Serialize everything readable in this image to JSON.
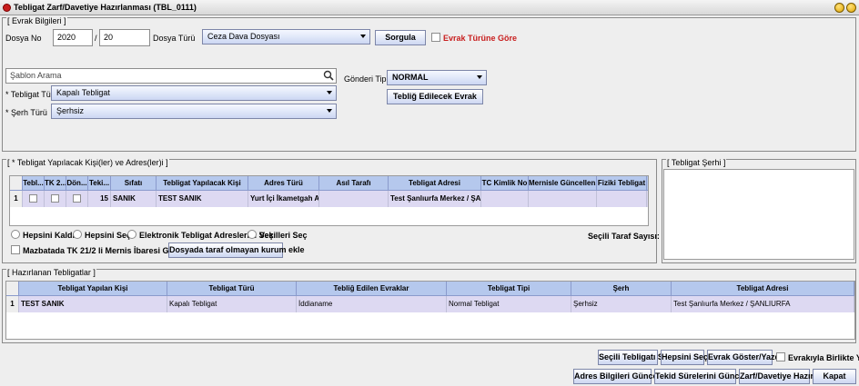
{
  "window": {
    "title": "Tebligat Zarf/Davetiye Hazırlanması (TBL_0111)"
  },
  "evrak": {
    "legend": "[ Evrak Bilgileri ]",
    "dosya_no_label": "Dosya No",
    "year": "2020",
    "slash": "/",
    "number": "20",
    "dosya_turu_label": "Dosya Türü",
    "dosya_turu_value": "Ceza Dava Dosyası",
    "sorgula": "Sorgula",
    "evrak_turune_gore": "Evrak Türüne Göre",
    "sablon_placeholder": "Şablon Arama",
    "tebligat_turu_label": "* Tebligat Türü",
    "tebligat_turu_value": "Kapalı Tebligat",
    "serh_turu_label": "* Şerh Türü",
    "serh_turu_value": "Şerhsiz",
    "gonderi_tipi_label": "Gönderi Tipi",
    "gonderi_tipi_value": "NORMAL",
    "teblig_edilecek": "Tebliğ Edilecek Evrak"
  },
  "kisiler": {
    "legend": "[ * Tebligat Yapılacak Kişi(ler) ve Adres(ler)i ]",
    "columns": [
      "Tebl...",
      "TK 2...",
      "Dön...",
      "Teki...",
      "Sıfatı",
      "Tebligat Yapılacak Kişi",
      "Adres Türü",
      "Asıl Tarafı",
      "Tebligat Adresi",
      "TC Kimlik No",
      "Mernisle Güncellen...",
      "Fiziki Tebligat"
    ],
    "row": {
      "num": "1",
      "teki": "15",
      "sifat": "SANIK",
      "kisi": "TEST SANIK",
      "adres_turu": "Yurt İçi İkametgah A...",
      "asil": "",
      "adres": "Test Şanlıurfa Merkez / ŞAN...",
      "tc": "",
      "mernis": "",
      "fiziki": ""
    },
    "radio_hepsini_kaldir": "Hepsini Kaldır",
    "radio_hepsini_sec": "Hepsini Seç",
    "radio_elektronik": "Elektronik Tebligat Adreslerini Seç",
    "radio_vekilleri": "Vekilleri Seç",
    "secili_taraf": "Seçili Taraf Sayısı: 0",
    "mazbatada": "Mazbatada TK 21/2 li Mernis İbaresi Görünsün",
    "dosyada_btn": "Dosyada taraf olmayan kurum ekle"
  },
  "serhi": {
    "legend": "[ Tebligat Şerhi ]"
  },
  "hazirlanan": {
    "legend": "[ Hazırlanan Tebligatlar ]",
    "columns": [
      "Tebligat Yapılan Kişi",
      "Tebligat Türü",
      "Tebliğ Edilen Evraklar",
      "Tebligat Tipi",
      "Şerh",
      "Tebligat Adresi"
    ],
    "row": {
      "num": "1",
      "kisi": "TEST SANIK",
      "turu": "Kapalı Tebligat",
      "evrak": "İddianame",
      "tipi": "Normal Tebligat",
      "serh": "Şerhsiz",
      "adres": "Test Şanlıurfa Merkez / ŞANLIURFA"
    }
  },
  "footer": {
    "secili_sil": "Seçili Tebligatı Sil",
    "hepsini_sec": "Hepsini Seç",
    "evrak_goster": "Evrak Göster/Yazdır",
    "evrakla_birlikte": "Evrakıyla Birlikte Yazdır",
    "adres_guncelle": "Adres Bilgileri Güncelle",
    "tekid": "Tekid Sürelerini Güncelle",
    "zarf": "Zarf/Davetiye Hazırla",
    "kapat": "Kapat"
  },
  "colors": {
    "header": "#b5c8ed",
    "row": "#ddd9f2",
    "accent_red": "#c81e1e"
  },
  "icons": [
    "app-icon",
    "search-icon",
    "minimize-icon",
    "close-icon"
  ]
}
